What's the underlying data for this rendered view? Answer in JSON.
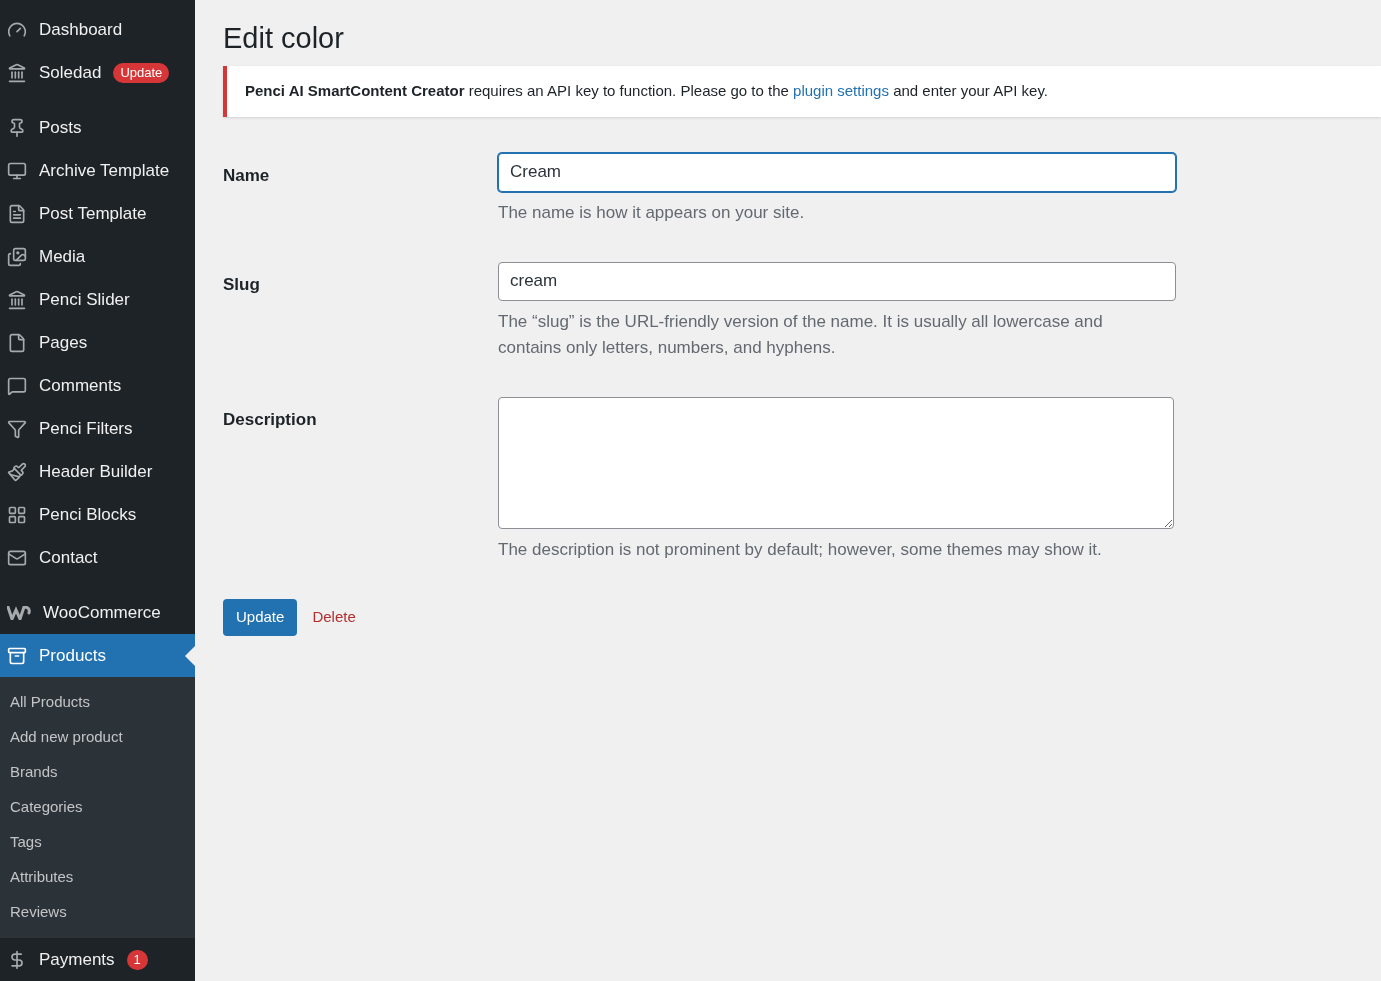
{
  "sidebar": {
    "items": [
      {
        "label": "Dashboard",
        "selected": false,
        "separator_after": false
      },
      {
        "label": "Soledad",
        "badge": "Update",
        "selected": false,
        "separator_after": true
      },
      {
        "label": "Posts",
        "selected": false,
        "separator_after": false
      },
      {
        "label": "Archive Template",
        "selected": false,
        "separator_after": false
      },
      {
        "label": "Post Template",
        "selected": false,
        "separator_after": false
      },
      {
        "label": "Media",
        "selected": false,
        "separator_after": false
      },
      {
        "label": "Penci Slider",
        "selected": false,
        "separator_after": false
      },
      {
        "label": "Pages",
        "selected": false,
        "separator_after": false
      },
      {
        "label": "Comments",
        "selected": false,
        "separator_after": false
      },
      {
        "label": "Penci Filters",
        "selected": false,
        "separator_after": false
      },
      {
        "label": "Header Builder",
        "selected": false,
        "separator_after": false
      },
      {
        "label": "Penci Blocks",
        "selected": false,
        "separator_after": false
      },
      {
        "label": "Contact",
        "selected": false,
        "separator_after": true
      },
      {
        "label": "WooCommerce",
        "selected": false,
        "separator_after": false
      },
      {
        "label": "Products",
        "selected": true,
        "separator_after": false,
        "children": [
          {
            "label": "All Products",
            "selected": false
          },
          {
            "label": "Add new product",
            "selected": false
          },
          {
            "label": "Brands",
            "selected": false
          },
          {
            "label": "Categories",
            "selected": false
          },
          {
            "label": "Tags",
            "selected": false
          },
          {
            "label": "Attributes",
            "selected": false
          },
          {
            "label": "Reviews",
            "selected": false
          }
        ]
      },
      {
        "label": "Payments",
        "badge": "1",
        "selected": false,
        "separator_after": false
      }
    ]
  },
  "page": {
    "title": "Edit color",
    "notice": {
      "text_before": "**Penci AI SmartContent Creator** requires an API key to function. Please go to the",
      "link": "plugin settings",
      "text_after": "and enter your API key."
    },
    "fields": [
      {
        "kind": "input",
        "label": "Name",
        "value": "Cream",
        "focused": true,
        "help": "The name is how it appears on your site."
      },
      {
        "kind": "input",
        "label": "Slug",
        "value": "cream",
        "focused": false,
        "help": "The “slug” is the URL-friendly version of the name. It is usually all lowercase and contains only letters, numbers, and hyphens."
      },
      {
        "kind": "textarea",
        "label": "Description",
        "focused": false,
        "help": "The description is not prominent by default; however, some themes may show it."
      }
    ],
    "actions": {
      "primary": "Update",
      "delete": "Delete"
    }
  }
}
